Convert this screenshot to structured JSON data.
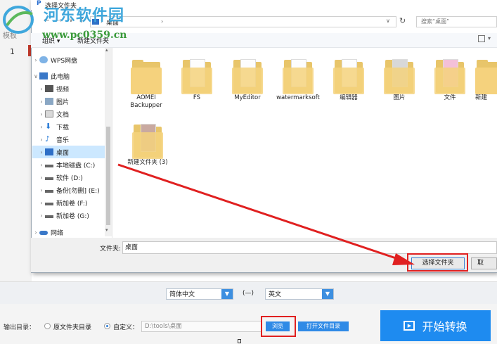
{
  "background_app": {
    "row_number": "1",
    "left_label": "模板"
  },
  "dialog": {
    "title": "选择文件夹",
    "address": "桌面",
    "search_placeholder": "搜索“桌面”",
    "toolbar": {
      "organize": "组织 ▾",
      "new_folder": "新建文件夹"
    },
    "nav": [
      {
        "label": "WPS网盘",
        "icon": "cloud-icon"
      },
      {
        "label": "此电脑",
        "icon": "computer-icon"
      },
      {
        "label": "视频",
        "icon": "video-icon"
      },
      {
        "label": "图片",
        "icon": "picture-icon"
      },
      {
        "label": "文档",
        "icon": "document-icon"
      },
      {
        "label": "下载",
        "icon": "download-icon"
      },
      {
        "label": "音乐",
        "icon": "music-icon"
      },
      {
        "label": "桌面",
        "icon": "desktop-icon"
      },
      {
        "label": "本地磁盘 (C:)",
        "icon": "drive-icon"
      },
      {
        "label": "软件 (D:)",
        "icon": "drive-icon"
      },
      {
        "label": "备份[勿删] (E:)",
        "icon": "drive-icon"
      },
      {
        "label": "新加卷 (F:)",
        "icon": "drive-icon"
      },
      {
        "label": "新加卷 (G:)",
        "icon": "drive-icon"
      },
      {
        "label": "网络",
        "icon": "network-icon"
      }
    ],
    "files": [
      {
        "name": "AOMEI Backupper"
      },
      {
        "name": "FS"
      },
      {
        "name": "MyEditor"
      },
      {
        "name": "watermarksoft"
      },
      {
        "name": "编辑器"
      },
      {
        "name": "图片"
      },
      {
        "name": "文件"
      },
      {
        "name": "新建"
      },
      {
        "name": "新建文件夹 (3)"
      }
    ],
    "folder_label": "文件夹:",
    "folder_value": "桌面",
    "select_button": "选择文件夹",
    "cancel_button": "取"
  },
  "language": {
    "source": "简体中文",
    "separator": "(—)",
    "target": "英文"
  },
  "output": {
    "label": "输出目录：",
    "option_original": "原文件夹目录",
    "option_custom": "自定义：",
    "path": "D:\\tools\\桌面",
    "browse_button": "浏览",
    "open_button": "打开文件目录"
  },
  "start_button": "开始转换",
  "watermark": {
    "site_name": "河东软件园",
    "url": "www.pc0359.cn"
  },
  "colors": {
    "accent": "#1e8bf0",
    "annotation": "#e02020",
    "folder": "#f5d27d"
  }
}
